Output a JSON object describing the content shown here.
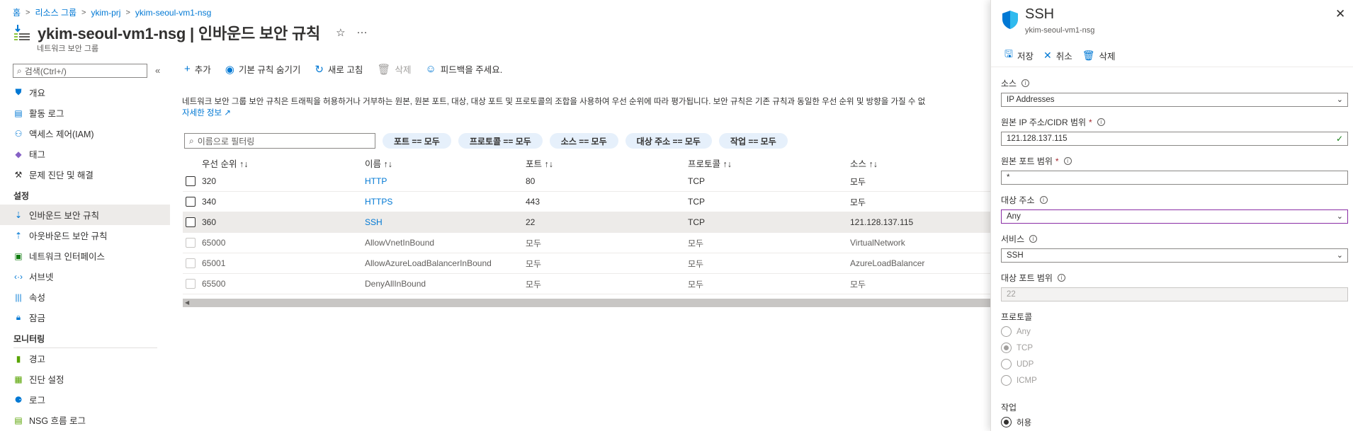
{
  "breadcrumb": {
    "home": "홈",
    "resource_groups": "리소스 그룹",
    "resource_group": "ykim-prj",
    "resource": "ykim-seoul-vm1-nsg"
  },
  "header": {
    "title_resource": "ykim-seoul-vm1-nsg",
    "title_separator": " | ",
    "title_page": "인바운드 보안 규칙",
    "subtitle": "네트워크 보안 그룹",
    "favorite_icon": "star-icon",
    "more_icon": "ellipsis-icon"
  },
  "sidebar": {
    "search_placeholder": "검색(Ctrl+/)",
    "collapse_label": "«",
    "items_top": [
      {
        "label": "개요",
        "icon": "shield-icon"
      },
      {
        "label": "활동 로그",
        "icon": "log-icon"
      },
      {
        "label": "액세스 제어(IAM)",
        "icon": "people-icon"
      },
      {
        "label": "태그",
        "icon": "tag-icon"
      },
      {
        "label": "문제 진단 및 해결",
        "icon": "wrench-icon"
      }
    ],
    "section_settings": "설정",
    "items_settings": [
      {
        "label": "인바운드 보안 규칙",
        "icon": "inbound-icon"
      },
      {
        "label": "아웃바운드 보안 규칙",
        "icon": "outbound-icon"
      },
      {
        "label": "네트워크 인터페이스",
        "icon": "nic-icon"
      },
      {
        "label": "서브넷",
        "icon": "subnet-icon"
      },
      {
        "label": "속성",
        "icon": "properties-icon"
      },
      {
        "label": "잠금",
        "icon": "lock-icon"
      }
    ],
    "section_monitoring": "모니터링",
    "items_monitoring": [
      {
        "label": "경고",
        "icon": "alert-icon"
      },
      {
        "label": "진단 설정",
        "icon": "diagnostic-icon"
      },
      {
        "label": "로그",
        "icon": "logs-icon"
      },
      {
        "label": "NSG 흐름 로그",
        "icon": "flow-log-icon"
      }
    ]
  },
  "toolbar": {
    "add": "추가",
    "hide_default": "기본 규칙 숨기기",
    "refresh": "새로 고침",
    "delete": "삭제",
    "feedback": "피드백을 주세요."
  },
  "description": {
    "text": "네트워크 보안 그룹 보안 규칙은 트래픽을 허용하거나 거부하는 원본, 원본 포트, 대상, 대상 포트 및 프로토콜의 조합을 사용하여 우선 순위에 따라 평가됩니다. 보안 규칙은 기존 규칙과 동일한 우선 순위 및 방향을 가질 수 없",
    "learn_more": "자세한 정보"
  },
  "filters": {
    "name_placeholder": "이름으로 필터링",
    "pills": [
      "포트 == 모두",
      "프로토콜 == 모두",
      "소스 == 모두",
      "대상 주소 == 모두",
      "작업 == 모두"
    ]
  },
  "table": {
    "headers": {
      "priority": "우선 순위 ↑↓",
      "name": "이름 ↑↓",
      "port": "포트 ↑↓",
      "protocol": "프로토콜 ↑↓",
      "source": "소스 ↑↓"
    },
    "rows": [
      {
        "priority": "320",
        "name": "HTTP",
        "port": "80",
        "protocol": "TCP",
        "source": "모두"
      },
      {
        "priority": "340",
        "name": "HTTPS",
        "port": "443",
        "protocol": "TCP",
        "source": "모두"
      },
      {
        "priority": "360",
        "name": "SSH",
        "port": "22",
        "protocol": "TCP",
        "source": "121.128.137.115"
      },
      {
        "priority": "65000",
        "name": "AllowVnetInBound",
        "port": "모두",
        "protocol": "모두",
        "source": "VirtualNetwork"
      },
      {
        "priority": "65001",
        "name": "AllowAzureLoadBalancerInBound",
        "port": "모두",
        "protocol": "모두",
        "source": "AzureLoadBalancer"
      },
      {
        "priority": "65500",
        "name": "DenyAllInBound",
        "port": "모두",
        "protocol": "모두",
        "source": "모두"
      }
    ]
  },
  "blade": {
    "title": "SSH",
    "subtitle": "ykim-seoul-vm1-nsg",
    "save": "저장",
    "cancel": "취소",
    "delete": "삭제",
    "source_label": "소스",
    "source_value": "IP Addresses",
    "source_ip_label": "원본 IP 주소/CIDR 범위",
    "source_ip_value": "121.128.137.115",
    "source_port_label": "원본 포트 범위",
    "source_port_value": "*",
    "dest_label": "대상 주소",
    "dest_value": "Any",
    "service_label": "서비스",
    "service_value": "SSH",
    "dest_port_label": "대상 포트 범위",
    "dest_port_value": "22",
    "protocol_label": "프로토콜",
    "protocol_options": [
      "Any",
      "TCP",
      "UDP",
      "ICMP"
    ],
    "protocol_selected": "TCP",
    "action_label": "작업",
    "action_option": "허용",
    "required_mark": "*",
    "colors": {
      "accent": "#0078d4",
      "focus": "#8a2da5",
      "valid": "#107c10"
    }
  }
}
